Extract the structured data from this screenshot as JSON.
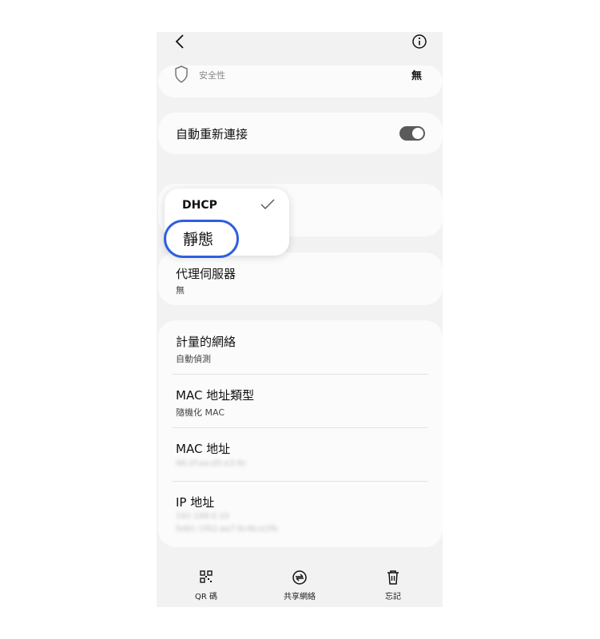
{
  "header": {
    "back_icon": "chevron-left-icon",
    "info_icon": "info-icon"
  },
  "security": {
    "label": "安全性",
    "value": "無",
    "icon": "shield-icon"
  },
  "auto_reconnect": {
    "label": "自動重新連接",
    "enabled": true
  },
  "ip_settings_menu": {
    "options": [
      "DHCP",
      "靜態"
    ],
    "selected": "DHCP"
  },
  "proxy": {
    "label": "代理伺服器",
    "value": "無"
  },
  "metered": {
    "label": "計量的網絡",
    "value": "自動偵測"
  },
  "mac_type": {
    "label": "MAC 地址類型",
    "value": "隨機化 MAC"
  },
  "mac_address": {
    "label": "MAC 地址",
    "value": "96:2f:aa:d5:e3:9c"
  },
  "ip_address": {
    "label": "IP 地址",
    "value_line1": "192.168.0.10",
    "value_line2": "fe80::1f02:aa7:9c4b:e2fb"
  },
  "bottom_nav": {
    "qr": {
      "label": "QR 碼",
      "icon": "qr-code-icon"
    },
    "share": {
      "label": "共享網絡",
      "icon": "share-network-icon"
    },
    "forget": {
      "label": "忘記",
      "icon": "trash-icon"
    }
  },
  "colors": {
    "accent": "#2f5fe0",
    "background": "#f2f2f2",
    "card": "#fbfbfb"
  }
}
